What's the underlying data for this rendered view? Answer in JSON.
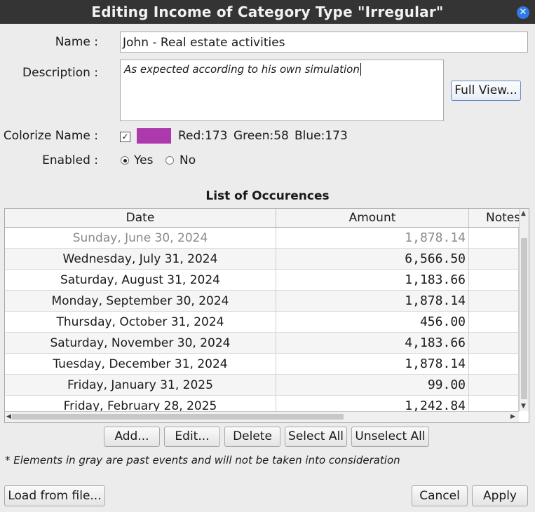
{
  "window": {
    "title": "Editing Income of Category Type \"Irregular\""
  },
  "form": {
    "name_label": "Name :",
    "name_value": "John - Real estate activities",
    "description_label": "Description :",
    "description_value": "As expected according to his own simulation",
    "full_view_label": "Full View...",
    "colorize_label": "Colorize Name :",
    "colorize_checked": true,
    "color_hex": "#ad3aad",
    "red_text": "Red:173",
    "green_text": "Green:58",
    "blue_text": "Blue:173",
    "enabled_label": "Enabled :",
    "yes_label": "Yes",
    "no_label": "No",
    "enabled_selected": "Yes"
  },
  "occurrences": {
    "title": "List of Occurences",
    "columns": [
      "Date",
      "Amount",
      "Notes"
    ],
    "rows": [
      {
        "date": "Sunday, June 30, 2024",
        "amount": "1,878.14",
        "notes": "",
        "past": true
      },
      {
        "date": "Wednesday, July 31, 2024",
        "amount": "6,566.50",
        "notes": ""
      },
      {
        "date": "Saturday, August 31, 2024",
        "amount": "1,183.66",
        "notes": ""
      },
      {
        "date": "Monday, September 30, 2024",
        "amount": "1,878.14",
        "notes": ""
      },
      {
        "date": "Thursday, October 31, 2024",
        "amount": "456.00",
        "notes": ""
      },
      {
        "date": "Saturday, November 30, 2024",
        "amount": "4,183.66",
        "notes": ""
      },
      {
        "date": "Tuesday, December 31, 2024",
        "amount": "1,878.14",
        "notes": ""
      },
      {
        "date": "Friday, January 31, 2025",
        "amount": "99.00",
        "notes": ""
      },
      {
        "date": "Friday, February 28, 2025",
        "amount": "1,242.84",
        "notes": ""
      }
    ]
  },
  "actions": {
    "add": "Add...",
    "edit": "Edit...",
    "delete": "Delete",
    "select_all": "Select All",
    "unselect_all": "Unselect All"
  },
  "footnote": "* Elements in gray are past events and will not be taken into consideration",
  "footer": {
    "load_from_file": "Load from file...",
    "cancel": "Cancel",
    "apply": "Apply"
  },
  "icons": {
    "close": "close-icon",
    "check": "✓"
  }
}
